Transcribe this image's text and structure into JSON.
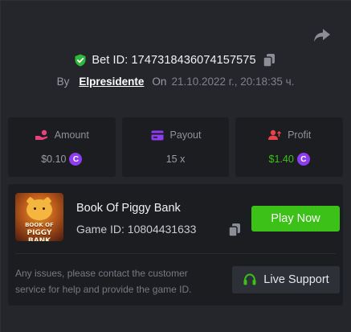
{
  "bet": {
    "label": "Bet ID: 1747318436074157575"
  },
  "byline": {
    "by": "By",
    "user": "Elpresidente",
    "on": "On",
    "date": "21.10.2022 г., 20:18:35 ч."
  },
  "stats": {
    "amount": {
      "label": "Amount",
      "value": "$0.10"
    },
    "payout": {
      "label": "Payout",
      "value": "15 x"
    },
    "profit": {
      "label": "Profit",
      "value": "$1.40"
    }
  },
  "coin_symbol": "C",
  "game": {
    "name": "Book Of Piggy Bank",
    "id_label": "Game ID: 10804431633",
    "thumb_line1": "BOOK OF",
    "thumb_line2": "PIGGY BANK"
  },
  "actions": {
    "play": "Play Now",
    "support": "Live Support"
  },
  "issue_text": "Any issues, please contact the customer service for help and provide the game ID.",
  "colors": {
    "background": "#24262b",
    "card": "#1b1d21",
    "accent_green": "#3bc117",
    "coin_purple": "#8e3cf0",
    "shield_green": "#2fb83a"
  },
  "icons": {
    "share": "share-arrow-icon",
    "shield": "shield-check-icon",
    "copy": "copy-icon",
    "amount": "coins-hand-icon",
    "payout": "card-icon",
    "profit": "profit-user-icon",
    "support": "headset-icon"
  }
}
